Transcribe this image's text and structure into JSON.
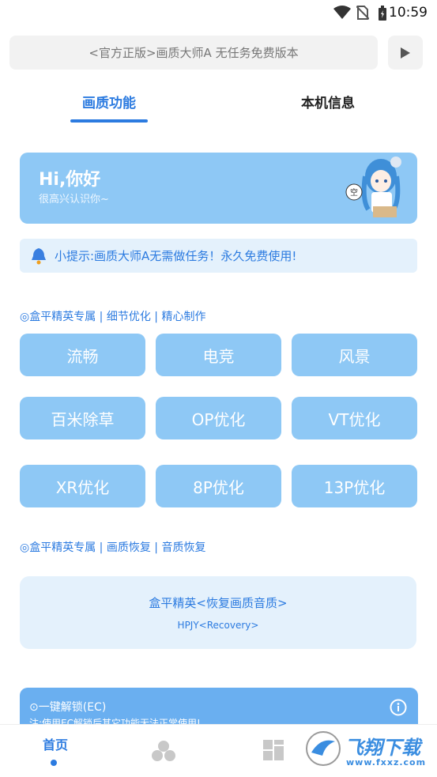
{
  "status_bar": {
    "time": "10:59",
    "icons": [
      "wifi-icon",
      "no-sim-icon",
      "battery-charging-icon"
    ]
  },
  "banner": {
    "text": "<官方正版>画质大师A 无任务免费版本",
    "play_icon": "play-icon"
  },
  "tabs": [
    {
      "label": "画质功能",
      "active": true
    },
    {
      "label": "本机信息",
      "active": false
    }
  ],
  "greeting": {
    "title": "Hi,你好",
    "subtitle": "很高兴认识你~",
    "bubble": "空"
  },
  "tip": {
    "icon": "bell-icon",
    "text": "小提示:画质大师A无需做任务！永久免费使用!"
  },
  "section1": {
    "title": "◎盒平精英专属 | 细节优化 | 精心制作",
    "buttons": [
      "流畅",
      "电竞",
      "风景",
      "百米除草",
      "OP优化",
      "VT优化",
      "XR优化",
      "8P优化",
      "13P优化"
    ]
  },
  "section2": {
    "title": "◎盒平精英专属 | 画质恢复 | 音质恢复"
  },
  "restore": {
    "title": "盒平精英<恢复画质音质>",
    "subtitle": "HPJY<Recovery>"
  },
  "unlock": {
    "title": "⊙一键解锁(EC)",
    "note": "注:使用EC解锁后其它功能无法正常使用!",
    "icon": "info-icon"
  },
  "bottom_nav": {
    "home_label": "首页",
    "items": [
      "home",
      "circles-icon",
      "grid-icon",
      "profile-icon"
    ]
  },
  "watermark": {
    "text": "飞翔下载",
    "url": "www.fxxz.com"
  },
  "colors": {
    "accent": "#2c7be0",
    "button": "#8ec8f5",
    "light": "#e4f1fc"
  }
}
